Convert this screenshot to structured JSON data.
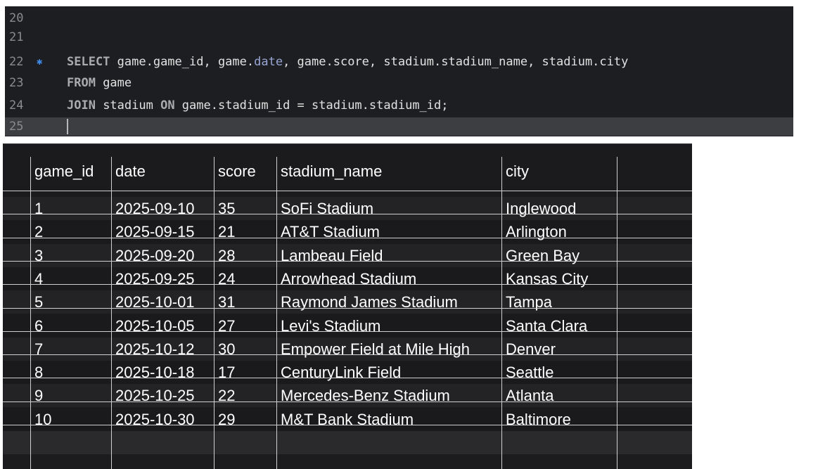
{
  "editor": {
    "lines": [
      {
        "number": "20"
      },
      {
        "number": "21"
      },
      {
        "number": "22",
        "marker": "✱",
        "tokens": [
          {
            "t": "SELECT",
            "k": "kw"
          },
          {
            "t": " game.game_id, game.",
            "k": "id"
          },
          {
            "t": "date",
            "k": "attr"
          },
          {
            "t": ", game.score, stadium.stadium_name, stadium.city",
            "k": "id"
          }
        ]
      },
      {
        "number": "23",
        "tokens": [
          {
            "t": "FROM",
            "k": "kw"
          },
          {
            "t": " game",
            "k": "id"
          }
        ]
      },
      {
        "number": "24",
        "tokens": [
          {
            "t": "JOIN",
            "k": "kw"
          },
          {
            "t": " stadium ",
            "k": "id"
          },
          {
            "t": "ON",
            "k": "kw"
          },
          {
            "t": " game.stadium_id = stadium.stadium_id;",
            "k": "id"
          }
        ]
      },
      {
        "number": "25",
        "current": true
      }
    ]
  },
  "results": {
    "columns": [
      "game_id",
      "date",
      "score",
      "stadium_name",
      "city"
    ],
    "rows": [
      [
        "1",
        "2025-09-10",
        "35",
        "SoFi Stadium",
        "Inglewood"
      ],
      [
        "2",
        "2025-09-15",
        "21",
        "AT&T Stadium",
        "Arlington"
      ],
      [
        "3",
        "2025-09-20",
        "28",
        "Lambeau Field",
        "Green Bay"
      ],
      [
        "4",
        "2025-09-25",
        "24",
        "Arrowhead Stadium",
        "Kansas City"
      ],
      [
        "5",
        "2025-10-01",
        "31",
        "Raymond James Stadium",
        "Tampa"
      ],
      [
        "6",
        "2025-10-05",
        "27",
        "Levi's Stadium",
        "Santa Clara"
      ],
      [
        "7",
        "2025-10-12",
        "30",
        "Empower Field at Mile High",
        "Denver"
      ],
      [
        "8",
        "2025-10-18",
        "17",
        "CenturyLink Field",
        "Seattle"
      ],
      [
        "9",
        "2025-10-25",
        "22",
        "Mercedes-Benz Stadium",
        "Atlanta"
      ],
      [
        "10",
        "2025-10-30",
        "29",
        "M&T Bank Stadium",
        "Baltimore"
      ]
    ]
  }
}
